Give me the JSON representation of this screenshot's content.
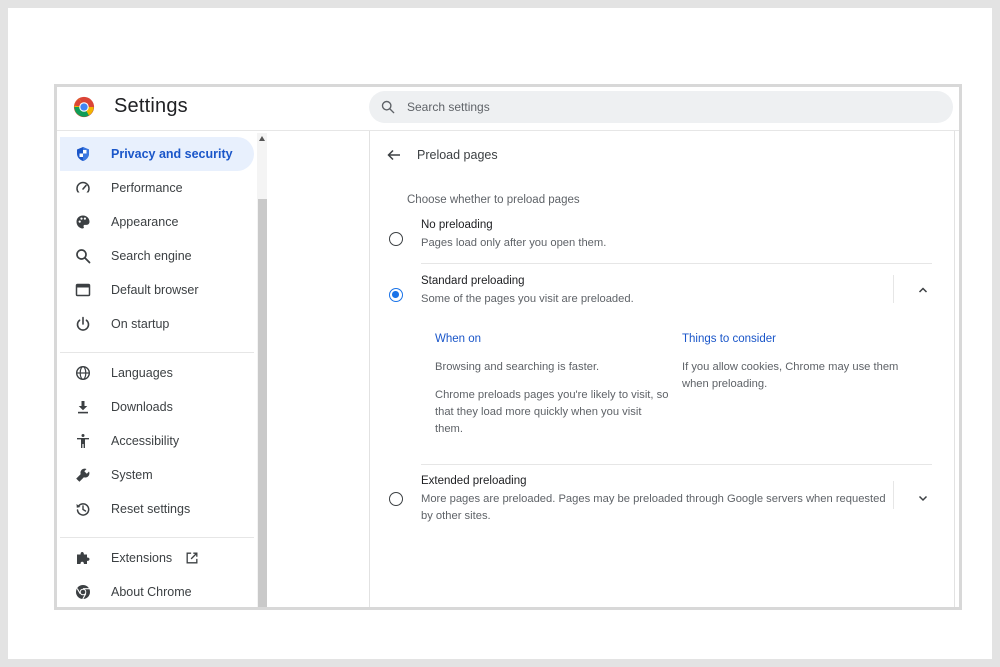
{
  "app": {
    "title": "Settings",
    "search_placeholder": "Search settings"
  },
  "sidebar": {
    "items": [
      {
        "label": "Privacy and security",
        "icon": "shield-icon",
        "active": true
      },
      {
        "label": "Performance",
        "icon": "speedometer-icon"
      },
      {
        "label": "Appearance",
        "icon": "palette-icon"
      },
      {
        "label": "Search engine",
        "icon": "search-icon"
      },
      {
        "label": "Default browser",
        "icon": "browser-window-icon"
      },
      {
        "label": "On startup",
        "icon": "power-icon"
      },
      {
        "label": "Languages",
        "icon": "globe-icon"
      },
      {
        "label": "Downloads",
        "icon": "download-icon"
      },
      {
        "label": "Accessibility",
        "icon": "accessibility-icon"
      },
      {
        "label": "System",
        "icon": "wrench-icon"
      },
      {
        "label": "Reset settings",
        "icon": "history-icon"
      },
      {
        "label": "Extensions",
        "icon": "puzzle-icon"
      },
      {
        "label": "About Chrome",
        "icon": "chrome-icon"
      }
    ]
  },
  "main": {
    "page_title": "Preload pages",
    "description": "Choose whether to preload pages",
    "options": [
      {
        "title": "No preloading",
        "subtitle": "Pages load only after you open them.",
        "selected": false
      },
      {
        "title": "Standard preloading",
        "subtitle": "Some of the pages you visit are preloaded.",
        "selected": true,
        "expanded": true,
        "when_on": {
          "heading": "When on",
          "p1": "Browsing and searching is faster.",
          "p2": "Chrome preloads pages you're likely to visit, so that they load more quickly when you visit them."
        },
        "things_to_consider": {
          "heading": "Things to consider",
          "p1": "If you allow cookies, Chrome may use them when preloading."
        }
      },
      {
        "title": "Extended preloading",
        "subtitle": "More pages are preloaded. Pages may be preloaded through Google servers when requested by other sites.",
        "selected": false,
        "expanded": false
      }
    ]
  },
  "colors": {
    "accent": "#1a73e8",
    "active_nav_bg": "#e8f0fd",
    "link_text": "#1a56c9"
  }
}
